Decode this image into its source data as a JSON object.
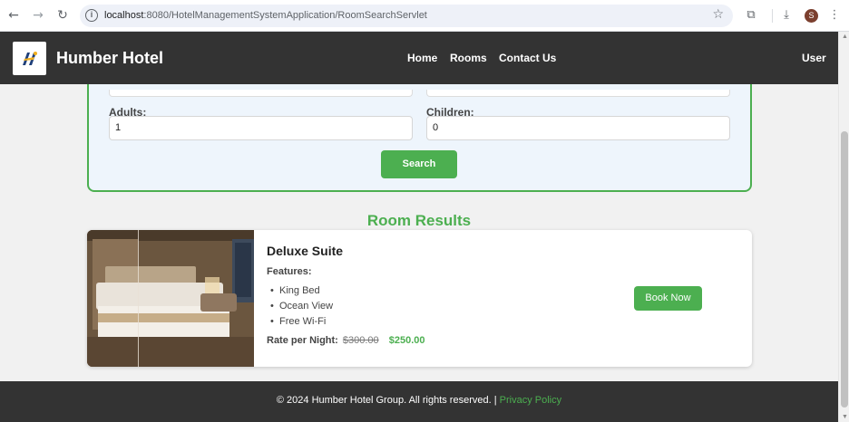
{
  "browser": {
    "url_host": "localhost",
    "url_path": ":8080/HotelManagementSystemApplication/RoomSearchServlet",
    "profile_initial": "S",
    "icons": [
      "back-arrow-icon",
      "forward-arrow-icon",
      "reload-icon",
      "site-info-icon",
      "bookmark-star-icon",
      "extensions-icon",
      "download-icon",
      "kebab-menu-icon"
    ]
  },
  "header": {
    "brand": "Humber Hotel",
    "nav": [
      "Home",
      "Rooms",
      "Contact Us"
    ],
    "user": "User",
    "logo_text": "H"
  },
  "search": {
    "adults_label": "Adults:",
    "adults_value": "1",
    "children_label": "Children:",
    "children_value": "0",
    "search_button": "Search"
  },
  "results": {
    "title": "Room Results",
    "rooms": [
      {
        "name": "Deluxe Suite",
        "features_label": "Features:",
        "features": [
          "King Bed",
          "Ocean View",
          "Free Wi-Fi"
        ],
        "rate_label": "Rate per Night:",
        "old_price": "$300.00",
        "new_price": "$250.00",
        "book_button": "Book Now"
      }
    ]
  },
  "footer": {
    "text": "© 2024 Humber Hotel Group. All rights reserved. |",
    "link": "Privacy Policy"
  },
  "colors": {
    "accent_green": "#4caf50",
    "header_dark": "#333333",
    "panel_bg": "#eef5fc"
  }
}
